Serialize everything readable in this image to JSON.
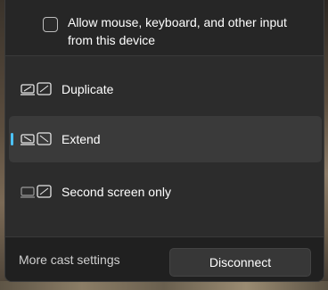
{
  "allow_input": {
    "label": "Allow mouse, keyboard, and other input from this device",
    "checked": false
  },
  "modes": [
    {
      "label": "Duplicate",
      "icon": "duplicate-icon",
      "selected": false
    },
    {
      "label": "Extend",
      "icon": "extend-icon",
      "selected": true
    },
    {
      "label": "Second screen only",
      "icon": "second-screen-only-icon",
      "selected": false
    }
  ],
  "footer": {
    "more_settings": "More cast settings",
    "disconnect": "Disconnect"
  },
  "colors": {
    "accent": "#4cc2ff",
    "panel": "#2c2c2c",
    "footer": "#202020",
    "selected_row": "#3a3a3a"
  }
}
